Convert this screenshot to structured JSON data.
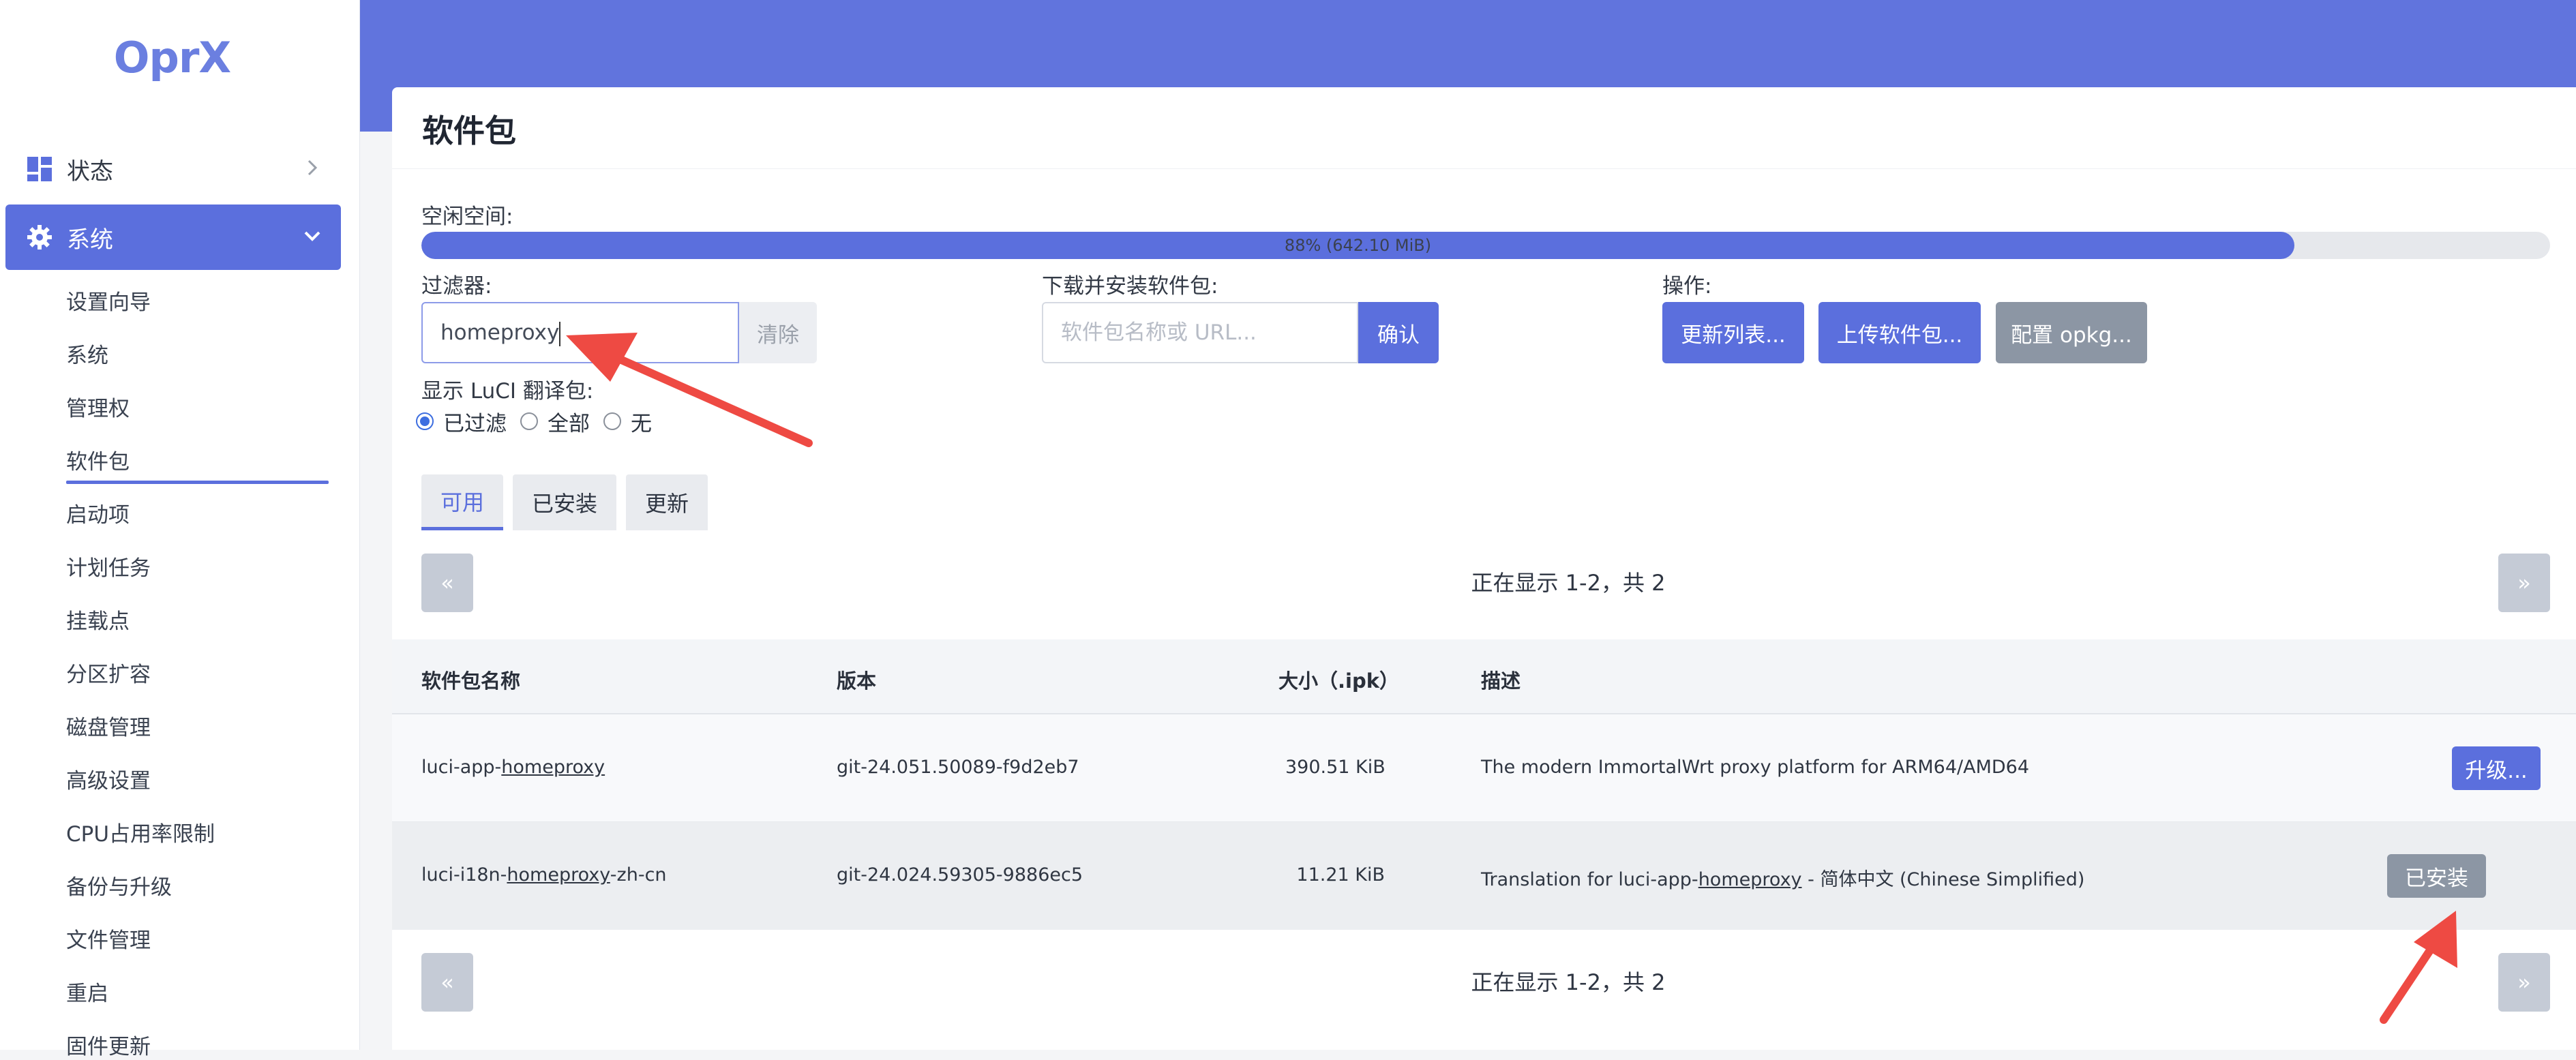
{
  "sidebar": {
    "logo": "OprX",
    "menu_status": "状态",
    "menu_system": "系统",
    "sub_items": [
      {
        "label": "设置向导"
      },
      {
        "label": "系统"
      },
      {
        "label": "管理权"
      },
      {
        "label": "软件包",
        "active": true
      },
      {
        "label": "启动项"
      },
      {
        "label": "计划任务"
      },
      {
        "label": "挂载点"
      },
      {
        "label": "分区扩容"
      },
      {
        "label": "磁盘管理"
      },
      {
        "label": "高级设置"
      },
      {
        "label": "CPU占用率限制"
      },
      {
        "label": "备份与升级"
      },
      {
        "label": "文件管理"
      },
      {
        "label": "重启"
      },
      {
        "label": "固件更新"
      }
    ]
  },
  "page": {
    "title": "软件包"
  },
  "free_space": {
    "label": "空闲空间:",
    "percent": 88,
    "text": "88% (642.10 MiB)"
  },
  "filter": {
    "label": "过滤器:",
    "value": "homeproxy",
    "clear_label": "清除"
  },
  "download": {
    "label": "下载并安装软件包:",
    "placeholder": "软件包名称或 URL...",
    "confirm_label": "确认"
  },
  "actions": {
    "label": "操作:",
    "update_list": "更新列表...",
    "upload": "上传软件包...",
    "configure": "配置 opkg..."
  },
  "luci_translation": {
    "label": "显示 LuCI 翻译包:",
    "options": [
      "已过滤",
      "全部",
      "无"
    ],
    "selected": "已过滤"
  },
  "tabs": {
    "available": "可用",
    "installed": "已安装",
    "updates": "更新",
    "active": "可用"
  },
  "pagination": {
    "prev": "«",
    "next": "»",
    "text": "正在显示 1-2，共 2"
  },
  "table": {
    "headers": {
      "name": "软件包名称",
      "version": "版本",
      "size": "大小（.ipk）",
      "description": "描述"
    },
    "rows": [
      {
        "name_prefix": "luci-app-",
        "name_match": "homeproxy",
        "name_suffix": "",
        "version": "git-24.051.50089-f9d2eb7",
        "size": "390.51 KiB",
        "desc_prefix": "The modern ImmortalWrt proxy platform for ARM64/AMD64",
        "desc_match": "",
        "desc_suffix": "",
        "action": "升级..."
      },
      {
        "name_prefix": "luci-i18n-",
        "name_match": "homeproxy",
        "name_suffix": "-zh-cn",
        "version": "git-24.024.59305-9886ec5",
        "size": "11.21 KiB",
        "desc_prefix": "Translation for luci-app-",
        "desc_match": "homeproxy",
        "desc_suffix": " - 简体中文 (Chinese Simplified)",
        "action": "已安装"
      }
    ]
  },
  "colors": {
    "accent": "#5b6fdd",
    "header": "#6174dd",
    "annotation_arrow": "#ee4a43"
  }
}
